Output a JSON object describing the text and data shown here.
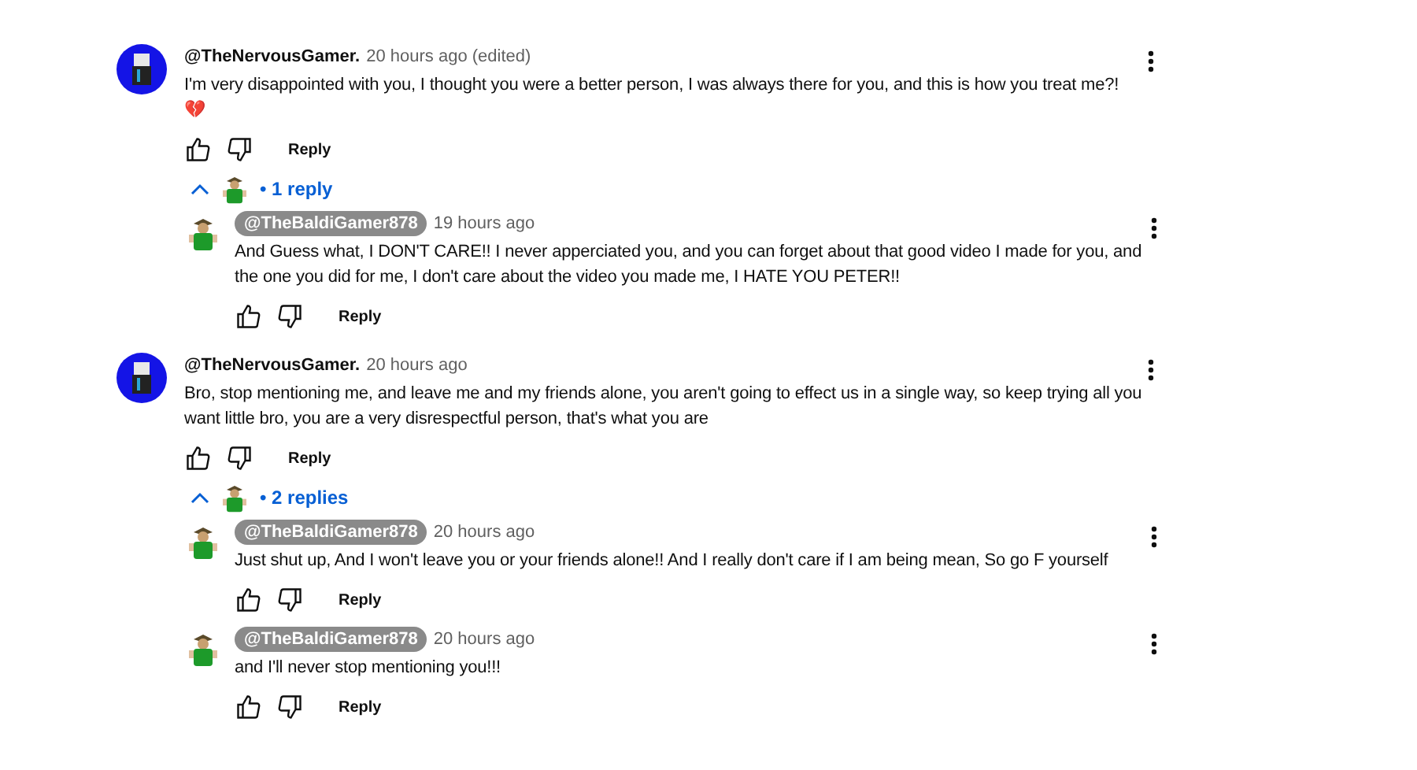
{
  "threads": [
    {
      "author": "@TheNervousGamer.",
      "author_highlighted": false,
      "time": "20 hours ago (edited)",
      "text": "I'm very disappointed with you, I thought you were a better person, I was always there for you, and this is how you treat me?! 💔",
      "reply_label": "Reply",
      "replies_toggle": {
        "expanded": true,
        "label": "• 1 reply"
      },
      "replies": [
        {
          "author": "@TheBaldiGamer878",
          "author_highlighted": true,
          "time": "19 hours ago",
          "text": "And Guess what, I DON'T CARE!! I never apperciated you, and you can forget about that good video I made for you, and the one you did for me, I don't care about the video you made me, I HATE YOU PETER!!",
          "reply_label": "Reply"
        }
      ]
    },
    {
      "author": "@TheNervousGamer.",
      "author_highlighted": false,
      "time": "20 hours ago",
      "text": "Bro, stop mentioning me, and leave me and my friends alone, you aren't going to effect us in a single way, so keep trying all you want little bro, you are a very disrespectful person, that's what you are",
      "reply_label": "Reply",
      "replies_toggle": {
        "expanded": true,
        "label": "• 2 replies"
      },
      "replies": [
        {
          "author": "@TheBaldiGamer878",
          "author_highlighted": true,
          "time": "20 hours ago",
          "text": "Just shut up, And I won't leave you or your friends alone!! And I really don't care if I am being mean, So go F yourself",
          "reply_label": "Reply"
        },
        {
          "author": "@TheBaldiGamer878",
          "author_highlighted": true,
          "time": "20 hours ago",
          "text": "and I'll never stop mentioning you!!!",
          "reply_label": "Reply"
        }
      ]
    }
  ]
}
